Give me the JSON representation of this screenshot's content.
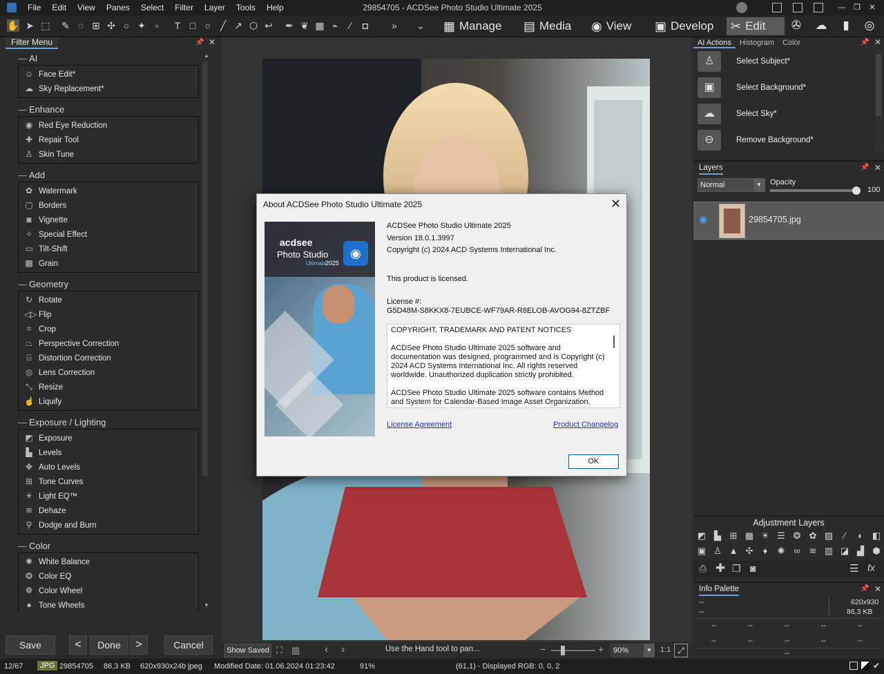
{
  "window": {
    "title": "29854705 - ACDSee Photo Studio Ultimate 2025",
    "menu": [
      "File",
      "Edit",
      "View",
      "Panes",
      "Select",
      "Filter",
      "Layer",
      "Tools",
      "Help"
    ]
  },
  "modes": [
    {
      "label": "Manage",
      "icon": "grid-icon"
    },
    {
      "label": "Media",
      "icon": "media-icon"
    },
    {
      "label": "View",
      "icon": "eye-icon"
    },
    {
      "label": "Develop",
      "icon": "develop-icon"
    },
    {
      "label": "Edit",
      "icon": "edit-icon",
      "active": true
    }
  ],
  "filter_menu": {
    "title": "Filter Menu",
    "groups": [
      {
        "title": "AI",
        "items": [
          "Face Edit*",
          "Sky Replacement*"
        ]
      },
      {
        "title": "Enhance",
        "items": [
          "Red Eye Reduction",
          "Repair Tool",
          "Skin Tune"
        ]
      },
      {
        "title": "Add",
        "items": [
          "Watermark",
          "Borders",
          "Vignette",
          "Special Effect",
          "Tilt-Shift",
          "Grain"
        ]
      },
      {
        "title": "Geometry",
        "items": [
          "Rotate",
          "Flip",
          "Crop",
          "Perspective Correction",
          "Distortion Correction",
          "Lens Correction",
          "Resize",
          "Liquify"
        ]
      },
      {
        "title": "Exposure / Lighting",
        "items": [
          "Exposure",
          "Levels",
          "Auto Levels",
          "Tone Curves",
          "Light EQ™",
          "Dehaze",
          "Dodge and Burn"
        ]
      },
      {
        "title": "Color",
        "items": [
          "White Balance",
          "Color EQ",
          "Color Wheel",
          "Tone Wheels"
        ]
      }
    ]
  },
  "bottom_buttons": {
    "save": "Save",
    "done": "Done",
    "cancel": "Cancel"
  },
  "dialog": {
    "title": "About ACDSee Photo Studio Ultimate 2025",
    "product": "ACDSee Photo Studio Ultimate 2025",
    "version": "Version 18.0.1.3997",
    "copyright": "Copyright (c) 2024 ACD Systems International Inc.",
    "licensed": "This product is licensed.",
    "license_label": "License #:",
    "license_key": "G5D48M-S8KKX8-7EUBCE-WF79AR-R8ELOB-AVOG94-8ZTZBF",
    "notice_lines": [
      "COPYRIGHT, TRADEMARK AND PATENT NOTICES",
      "",
      "ACDSee Photo Studio Ultimate 2025 software and documentation was designed, programmed and is Copyright (c) 2024 ACD Systems International Inc. All rights reserved worldwide. Unauthorized duplication strictly prohibited.",
      "",
      "ACDSee Photo Studio Ultimate 2025 software contains Method and System for Calendar-Based Image Asset Organization."
    ],
    "license_link": "License Agreement",
    "changelog_link": "Product Changelog",
    "ok": "OK",
    "logo_brand": "acdsee",
    "logo_product": "Photo Studio",
    "logo_edition": "Ultimate",
    "logo_year": "2025"
  },
  "right_panel": {
    "tabs": [
      "AI Actions",
      "Histogram",
      "Color"
    ],
    "ai_actions": [
      "Select Subject*",
      "Select Background*",
      "Select Sky*",
      "Remove Background*"
    ],
    "layers_title": "Layers",
    "blend_mode": "Normal",
    "opacity_label": "Opacity",
    "opacity_value": "100",
    "layer_name": "29854705.jpg",
    "adjustment_title": "Adjustment Layers",
    "info_title": "Info Palette",
    "info": {
      "dims": "620x930",
      "size": "86,3 KB",
      "placeholder": "--"
    }
  },
  "bottom_bar": {
    "show_saved": "Show Saved",
    "hint": "Use the Hand tool to pan...",
    "zoom": "90%",
    "ratio": "1:1"
  },
  "status": {
    "index": "12/67",
    "format": "JPG",
    "filename": "29854705",
    "filesize": "86,3 KB",
    "dims": "620x930x24b jpeg",
    "modified": "Modified Date: 01.06.2024 01:23:42",
    "zoom": "91%",
    "pixel": "(61,1) - Displayed RGB: 0, 0, 2"
  },
  "colors": {
    "accent": "#6fa0d8",
    "panel": "#2b2b2b",
    "dialog": "#f0f0f0",
    "link": "#1a3bb0"
  }
}
